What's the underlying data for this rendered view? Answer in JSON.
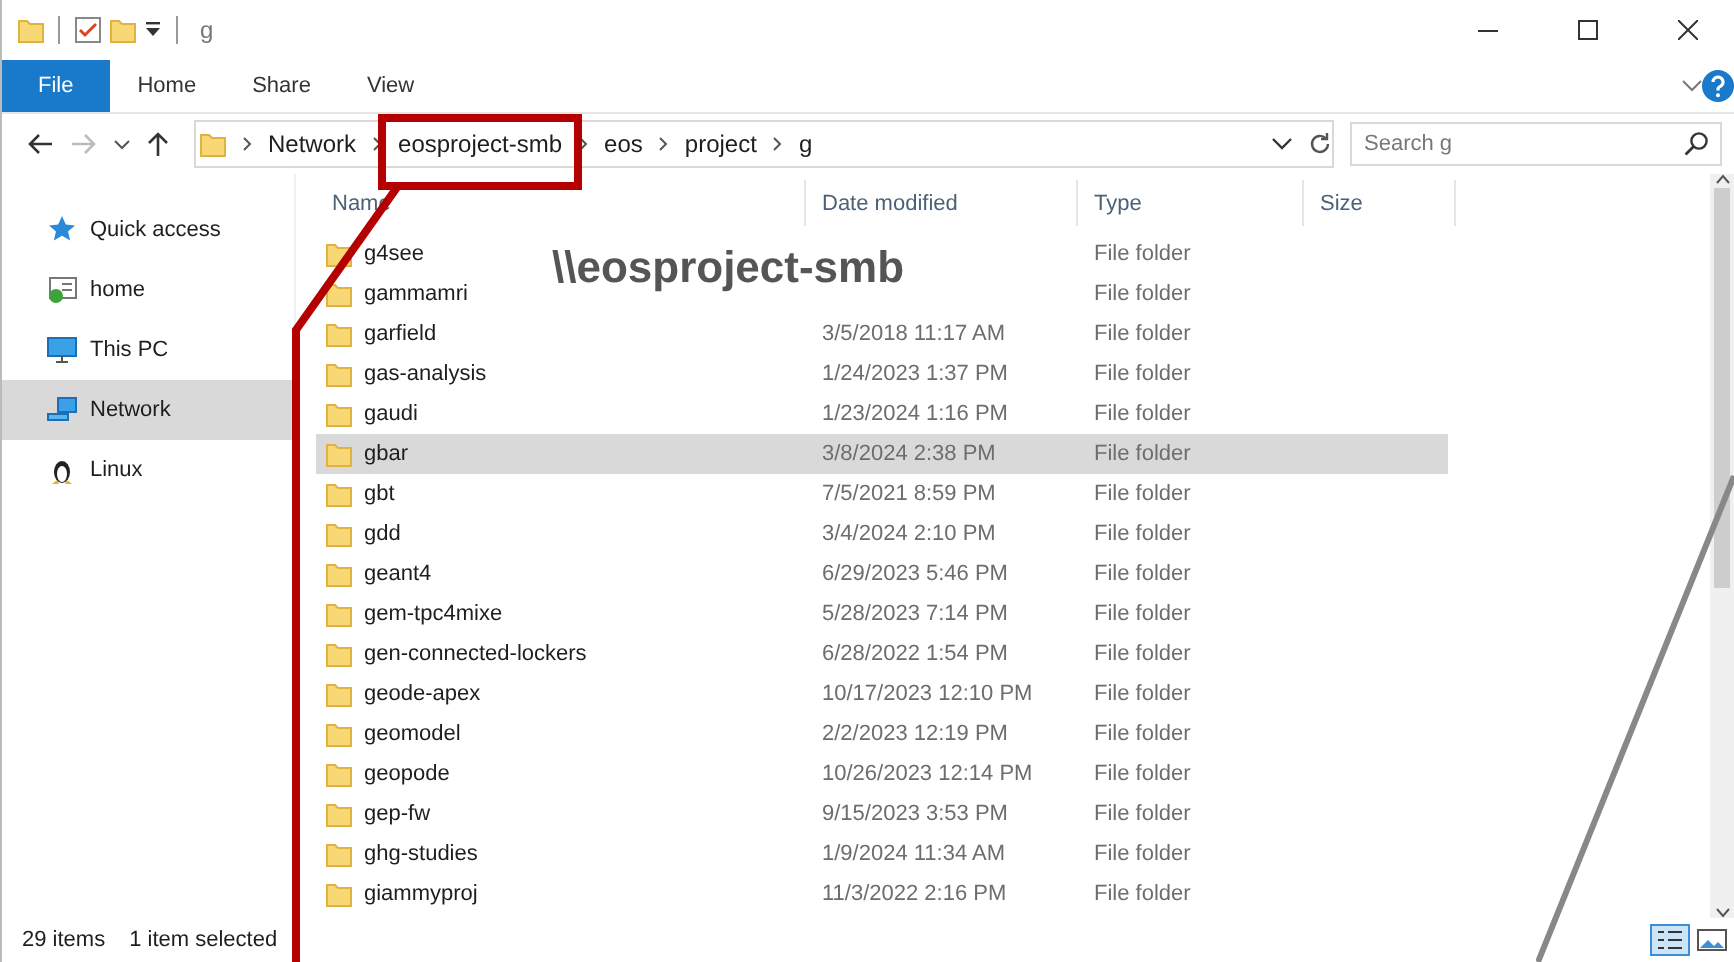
{
  "window": {
    "title": "g"
  },
  "ribbon": {
    "tabs": [
      {
        "label": "File",
        "selected": true
      },
      {
        "label": "Home",
        "selected": false
      },
      {
        "label": "Share",
        "selected": false
      },
      {
        "label": "View",
        "selected": false
      }
    ]
  },
  "address": {
    "crumbs": [
      "Network",
      "eosproject-smb",
      "eos",
      "project",
      "g"
    ],
    "search": {
      "placeholder": "Search g"
    }
  },
  "sidebar": {
    "items": [
      {
        "label": "Quick access",
        "kind": "star",
        "selected": false
      },
      {
        "label": "home",
        "kind": "drive",
        "selected": false
      },
      {
        "label": "This PC",
        "kind": "pc",
        "selected": false
      },
      {
        "label": "Network",
        "kind": "network",
        "selected": true
      },
      {
        "label": "Linux",
        "kind": "linux",
        "selected": false
      }
    ]
  },
  "table": {
    "columns": [
      "Name",
      "Date modified",
      "Type",
      "Size"
    ],
    "rows": [
      {
        "name": "g4see",
        "date": null,
        "type": "File folder",
        "selected": false
      },
      {
        "name": "gammamri",
        "date": null,
        "type": "File folder",
        "selected": false
      },
      {
        "name": "garfield",
        "date": "3/5/2018 11:17 AM",
        "type": "File folder",
        "selected": false
      },
      {
        "name": "gas-analysis",
        "date": "1/24/2023 1:37 PM",
        "type": "File folder",
        "selected": false
      },
      {
        "name": "gaudi",
        "date": "1/23/2024 1:16 PM",
        "type": "File folder",
        "selected": false
      },
      {
        "name": "gbar",
        "date": "3/8/2024 2:38 PM",
        "type": "File folder",
        "selected": true
      },
      {
        "name": "gbt",
        "date": "7/5/2021 8:59 PM",
        "type": "File folder",
        "selected": false
      },
      {
        "name": "gdd",
        "date": "3/4/2024 2:10 PM",
        "type": "File folder",
        "selected": false
      },
      {
        "name": "geant4",
        "date": "6/29/2023 5:46 PM",
        "type": "File folder",
        "selected": false
      },
      {
        "name": "gem-tpc4mixe",
        "date": "5/28/2023 7:14 PM",
        "type": "File folder",
        "selected": false
      },
      {
        "name": "gen-connected-lockers",
        "date": "6/28/2022 1:54 PM",
        "type": "File folder",
        "selected": false
      },
      {
        "name": "geode-apex",
        "date": "10/17/2023 12:10 PM",
        "type": "File folder",
        "selected": false
      },
      {
        "name": "geomodel",
        "date": "2/2/2023 12:19 PM",
        "type": "File folder",
        "selected": false
      },
      {
        "name": "geopode",
        "date": "10/26/2023 12:14 PM",
        "type": "File folder",
        "selected": false
      },
      {
        "name": "gep-fw",
        "date": "9/15/2023 3:53 PM",
        "type": "File folder",
        "selected": false
      },
      {
        "name": "ghg-studies",
        "date": "1/9/2024 11:34 AM",
        "type": "File folder",
        "selected": false
      },
      {
        "name": "giammyproj",
        "date": "11/3/2022 2:16 PM",
        "type": "File folder",
        "selected": false
      }
    ]
  },
  "status_bar": {
    "count": "29 items",
    "selection": "1 item selected"
  },
  "annotation": {
    "label": "\\\\eosproject-smb"
  }
}
